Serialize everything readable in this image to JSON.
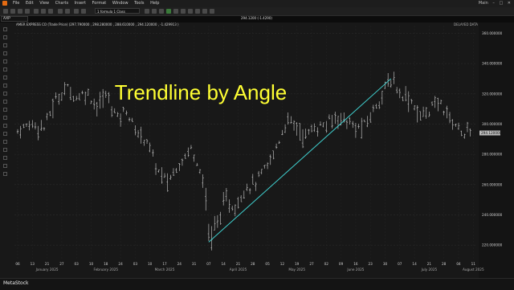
{
  "menubar": {
    "items": [
      "File",
      "Edit",
      "View",
      "Charts",
      "Insert",
      "Format",
      "Window",
      "Tools",
      "Help"
    ],
    "workspace": "Main"
  },
  "toolbar": {
    "layout_combo": "1 formula 1 Class"
  },
  "symbol_box": "AXP",
  "header": {
    "info": "AMER EXPRESS CO (Trade Price)  (297.790000 ,  298.280000 ,  288.610000 ,  294.120000 ,  -1.429913 )",
    "ohlc_readout": "294.1200 (-1.4290)",
    "delayed": "DELAYED DATA"
  },
  "overlay_title": "Trendline by Angle",
  "status": {
    "brand": "MetaStock"
  },
  "chart_data": {
    "type": "ohlc",
    "ylim": [
      210,
      365
    ],
    "y_ticks": [
      {
        "v": 360,
        "label": "360.000000"
      },
      {
        "v": 340,
        "label": "340.000000"
      },
      {
        "v": 320,
        "label": "320.000000"
      },
      {
        "v": 300,
        "label": "300.000000"
      },
      {
        "v": 280,
        "label": "280.000000"
      },
      {
        "v": 260,
        "label": "260.000000"
      },
      {
        "v": 240,
        "label": "240.000000"
      },
      {
        "v": 220,
        "label": "220.000000"
      }
    ],
    "last_price_label": "294.120000",
    "last_price": 294.12,
    "x_ticks": [
      "06",
      "13",
      "21",
      "27",
      "03",
      "10",
      "18",
      "24",
      "03",
      "10",
      "17",
      "24",
      "31",
      "07",
      "14",
      "21",
      "28",
      "05",
      "12",
      "19",
      "27",
      "02",
      "09",
      "16",
      "23",
      "30",
      "07",
      "14",
      "21",
      "28",
      "04",
      "11"
    ],
    "x_months": [
      {
        "label": "January 2025",
        "tick_index": 2
      },
      {
        "label": "February 2025",
        "tick_index": 6
      },
      {
        "label": "March 2025",
        "tick_index": 10
      },
      {
        "label": "April 2025",
        "tick_index": 15
      },
      {
        "label": "May 2025",
        "tick_index": 19
      },
      {
        "label": "June 2025",
        "tick_index": 23
      },
      {
        "label": "July 2025",
        "tick_index": 28
      },
      {
        "label": "August 2025",
        "tick_index": 31
      }
    ],
    "trendline": {
      "from": {
        "tick_index": 13,
        "value": 222
      },
      "to": {
        "tick_index": 25.4,
        "value": 330
      },
      "color": "#3fd0cf"
    },
    "price_anchors": [
      {
        "t": 0,
        "v": 296
      },
      {
        "t": 1,
        "v": 301
      },
      {
        "t": 1.8,
        "v": 298
      },
      {
        "t": 2.5,
        "v": 315
      },
      {
        "t": 3.3,
        "v": 325
      },
      {
        "t": 4.0,
        "v": 318
      },
      {
        "t": 4.7,
        "v": 322
      },
      {
        "t": 5.4,
        "v": 312
      },
      {
        "t": 6.0,
        "v": 320
      },
      {
        "t": 6.8,
        "v": 305
      },
      {
        "t": 7.4,
        "v": 310
      },
      {
        "t": 8.0,
        "v": 296
      },
      {
        "t": 8.8,
        "v": 290
      },
      {
        "t": 9.5,
        "v": 270
      },
      {
        "t": 10.2,
        "v": 262
      },
      {
        "t": 11.0,
        "v": 275
      },
      {
        "t": 11.8,
        "v": 285
      },
      {
        "t": 12.5,
        "v": 270
      },
      {
        "t": 12.9,
        "v": 240
      },
      {
        "t": 13.1,
        "v": 225
      },
      {
        "t": 13.6,
        "v": 238
      },
      {
        "t": 14.2,
        "v": 250
      },
      {
        "t": 14.8,
        "v": 245
      },
      {
        "t": 15.4,
        "v": 258
      },
      {
        "t": 16.2,
        "v": 262
      },
      {
        "t": 17.0,
        "v": 272
      },
      {
        "t": 17.8,
        "v": 290
      },
      {
        "t": 18.3,
        "v": 303
      },
      {
        "t": 18.9,
        "v": 300
      },
      {
        "t": 19.5,
        "v": 292
      },
      {
        "t": 20.2,
        "v": 298
      },
      {
        "t": 21.0,
        "v": 300
      },
      {
        "t": 21.8,
        "v": 306
      },
      {
        "t": 22.5,
        "v": 302
      },
      {
        "t": 23.0,
        "v": 297
      },
      {
        "t": 23.7,
        "v": 300
      },
      {
        "t": 24.3,
        "v": 312
      },
      {
        "t": 24.9,
        "v": 322
      },
      {
        "t": 25.4,
        "v": 330
      },
      {
        "t": 26.0,
        "v": 322
      },
      {
        "t": 26.8,
        "v": 316
      },
      {
        "t": 27.4,
        "v": 305
      },
      {
        "t": 28.2,
        "v": 312
      },
      {
        "t": 28.8,
        "v": 314
      },
      {
        "t": 29.3,
        "v": 306
      },
      {
        "t": 29.8,
        "v": 300
      },
      {
        "t": 30.3,
        "v": 295
      },
      {
        "t": 30.8,
        "v": 294
      }
    ]
  },
  "colors": {
    "bar": "#d0d0d0",
    "trend": "#3fd0cf",
    "title": "#ffff33",
    "price_tag_bg": "#bbbbbb"
  },
  "icons": [
    "metastock-logo-icon",
    "cursor-icon",
    "line-tool-icon",
    "zoom-icon",
    "minimize-icon",
    "maximize-icon",
    "close-icon"
  ]
}
